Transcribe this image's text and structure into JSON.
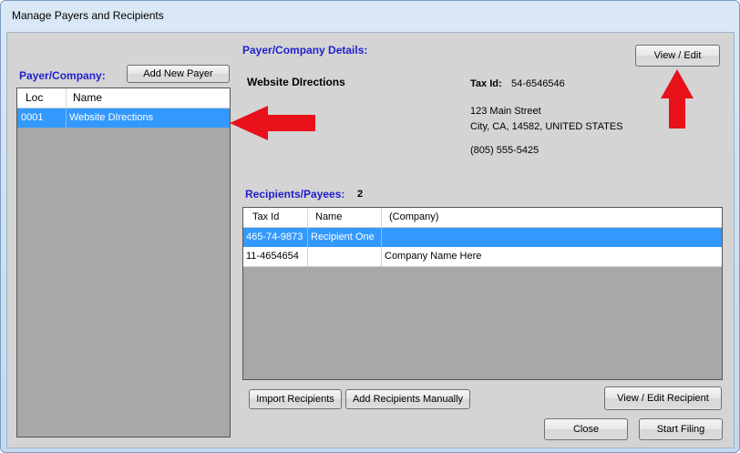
{
  "window": {
    "title": "Manage Payers and Recipients"
  },
  "payer_panel": {
    "label": "Payer/Company:",
    "add_button": "Add New Payer",
    "columns": [
      "Loc",
      "Name"
    ],
    "rows": [
      {
        "loc": "0001",
        "name": "Website DIrections"
      }
    ]
  },
  "details": {
    "label": "Payer/Company Details:",
    "view_edit_button": "View / Edit",
    "name": "Website DIrections",
    "tax_id_label": "Tax Id:",
    "tax_id": "54-6546546",
    "address1": "123 Main Street",
    "address2": "City, CA, 14582, UNITED STATES",
    "phone": "(805) 555-5425"
  },
  "recipients": {
    "label": "Recipients/Payees:",
    "count": "2",
    "columns": [
      "Tax Id",
      "Name",
      "(Company)"
    ],
    "rows": [
      {
        "tax_id": "465-74-9873",
        "name": "Recipient  One",
        "company": ""
      },
      {
        "tax_id": "11-4654654",
        "name": "",
        "company": "Company Name Here"
      }
    ]
  },
  "buttons": {
    "import": "Import Recipients",
    "add_manually": "Add Recipients Manually",
    "view_edit_recipient": "View / Edit Recipient",
    "close": "Close",
    "start_filing": "Start Filing"
  },
  "colors": {
    "selection": "#3399ff",
    "label_blue": "#1f1fcc",
    "arrow_red": "#e8111a"
  }
}
